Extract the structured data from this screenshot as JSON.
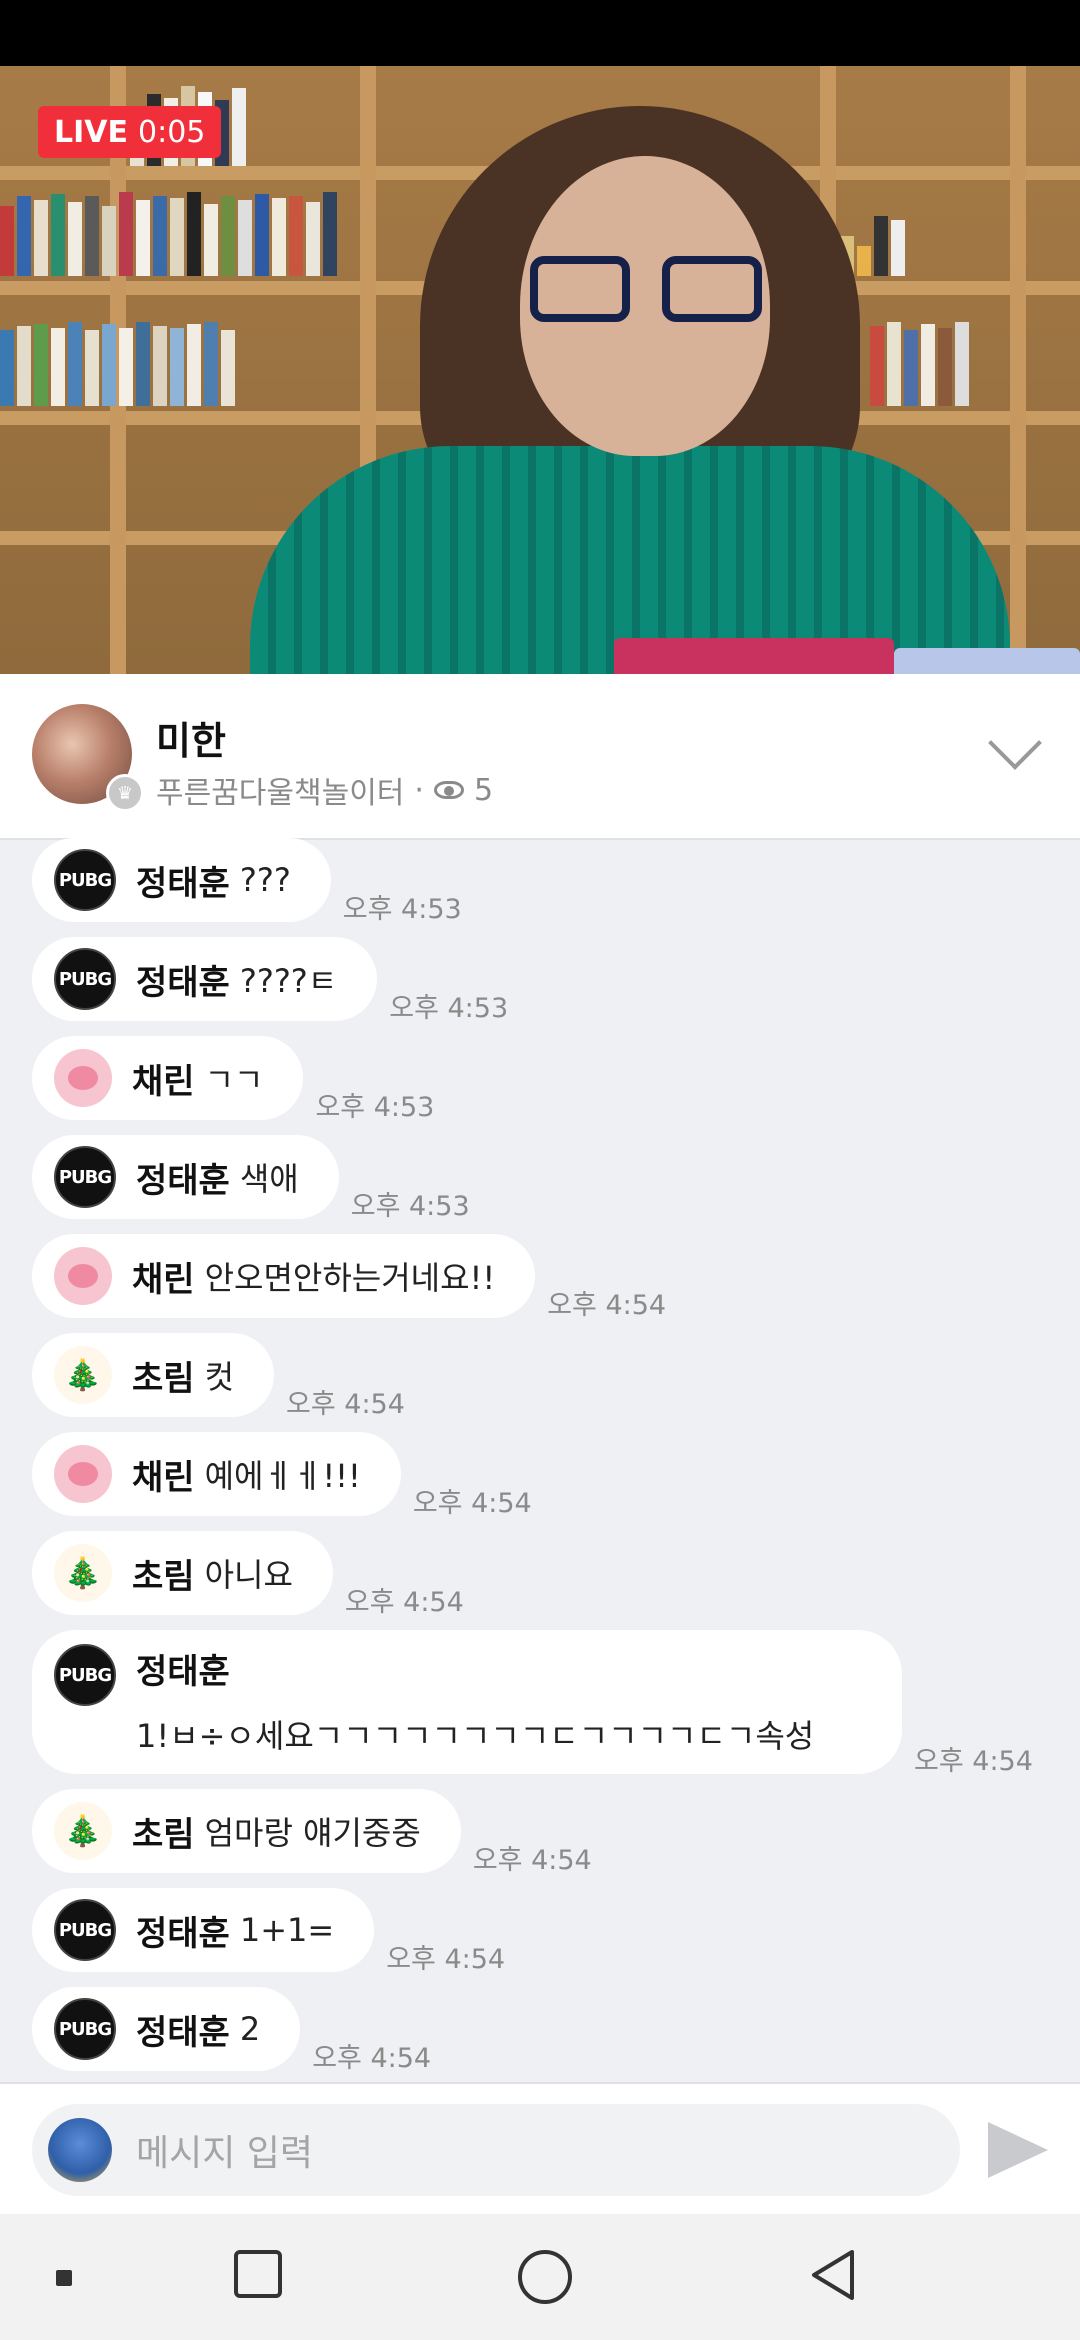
{
  "stream": {
    "live_label": "LIVE",
    "elapsed": "0:05"
  },
  "header": {
    "host_name": "미한",
    "channel": "푸른꿈다울책놀이터",
    "separator": "·",
    "viewer_count": "5"
  },
  "messages": [
    {
      "user": "정태훈",
      "text": "???",
      "time": "오후 4:53",
      "avatar": "pubg"
    },
    {
      "user": "정태훈",
      "text": "????ㅌ",
      "time": "오후 4:53",
      "avatar": "pubg"
    },
    {
      "user": "채린",
      "text": "ㄱㄱ",
      "time": "오후 4:53",
      "avatar": "pink"
    },
    {
      "user": "정태훈",
      "text": "색애",
      "time": "오후 4:53",
      "avatar": "pubg"
    },
    {
      "user": "채린",
      "text": "안오면안하는거네요!!",
      "time": "오후 4:54",
      "avatar": "pink"
    },
    {
      "user": "초림",
      "text": "컷",
      "time": "오후 4:54",
      "avatar": "tree"
    },
    {
      "user": "채린",
      "text": "예에ㅔㅔ!!!",
      "time": "오후 4:54",
      "avatar": "pink"
    },
    {
      "user": "초림",
      "text": "아니요",
      "time": "오후 4:54",
      "avatar": "tree"
    },
    {
      "user": "정태훈",
      "text": "1!ㅂ÷ㅇ세요ㄱㄱㄱㄱㄱㄱㄱㄱㄷㄱㄱㄱㄱㄷㄱ속성",
      "time": "오후 4:54",
      "avatar": "pubg"
    },
    {
      "user": "초림",
      "text": "엄마랑 얘기중중",
      "time": "오후 4:54",
      "avatar": "tree"
    },
    {
      "user": "정태훈",
      "text": "1+1=",
      "time": "오후 4:54",
      "avatar": "pubg"
    },
    {
      "user": "정태훈",
      "text": "2",
      "time": "오후 4:54",
      "avatar": "pubg"
    }
  ],
  "avatar_labels": {
    "pubg": "PUBG",
    "tree": "🎄"
  },
  "input": {
    "placeholder": "메시지 입력"
  },
  "colors": {
    "live_badge": "#f12f3a",
    "chat_bg": "#eef0f3",
    "bubble": "#ffffff"
  }
}
